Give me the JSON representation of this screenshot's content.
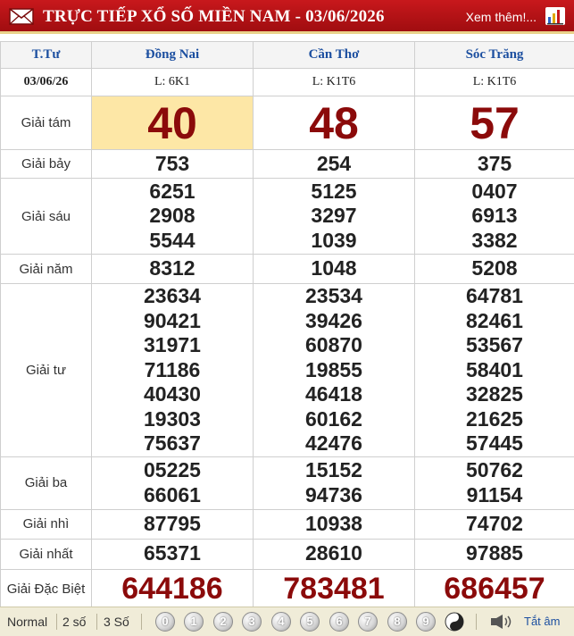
{
  "header": {
    "title": "TRỰC TIẾP XỔ SỐ MIỀN NAM - 03/06/2026",
    "more_link": "Xem thêm!..."
  },
  "table": {
    "col_header": "T.Tư",
    "date": "03/06/26",
    "provinces": [
      {
        "name": "Đồng Nai",
        "code": "L: 6K1"
      },
      {
        "name": "Cần Thơ",
        "code": "L: K1T6"
      },
      {
        "name": "Sóc Trăng",
        "code": "L: K1T6"
      }
    ],
    "rows": [
      {
        "label": "Giải tám",
        "values": [
          [
            "40"
          ],
          [
            "48"
          ],
          [
            "57"
          ]
        ]
      },
      {
        "label": "Giải bảy",
        "values": [
          [
            "753"
          ],
          [
            "254"
          ],
          [
            "375"
          ]
        ]
      },
      {
        "label": "Giải sáu",
        "values": [
          [
            "6251",
            "2908",
            "5544"
          ],
          [
            "5125",
            "3297",
            "1039"
          ],
          [
            "0407",
            "6913",
            "3382"
          ]
        ]
      },
      {
        "label": "Giải năm",
        "values": [
          [
            "8312"
          ],
          [
            "1048"
          ],
          [
            "5208"
          ]
        ]
      },
      {
        "label": "Giải tư",
        "values": [
          [
            "23634",
            "90421",
            "31971",
            "71186",
            "40430",
            "19303",
            "75637"
          ],
          [
            "23534",
            "39426",
            "60870",
            "19855",
            "46418",
            "60162",
            "42476"
          ],
          [
            "64781",
            "82461",
            "53567",
            "58401",
            "32825",
            "21625",
            "57445"
          ]
        ]
      },
      {
        "label": "Giải ba",
        "values": [
          [
            "05225",
            "66061"
          ],
          [
            "15152",
            "94736"
          ],
          [
            "50762",
            "91154"
          ]
        ]
      },
      {
        "label": "Giải nhì",
        "values": [
          [
            "87795"
          ],
          [
            "10938"
          ],
          [
            "74702"
          ]
        ]
      },
      {
        "label": "Giải nhất",
        "values": [
          [
            "65371"
          ],
          [
            "28610"
          ],
          [
            "97885"
          ]
        ]
      },
      {
        "label": "Giải Đặc Biệt",
        "values": [
          [
            "644186"
          ],
          [
            "783481"
          ],
          [
            "686457"
          ]
        ]
      }
    ]
  },
  "footer": {
    "modes": [
      "Normal",
      "2 số",
      "3 Số"
    ],
    "digits": [
      "0",
      "1",
      "2",
      "3",
      "4",
      "5",
      "6",
      "7",
      "8",
      "9"
    ],
    "mute_label": "Tắt âm"
  },
  "colors": {
    "header_red": "#b5121b",
    "prize_red": "#8b0a0a",
    "highlight": "#fde7a6",
    "province_blue": "#1c4fa0"
  }
}
